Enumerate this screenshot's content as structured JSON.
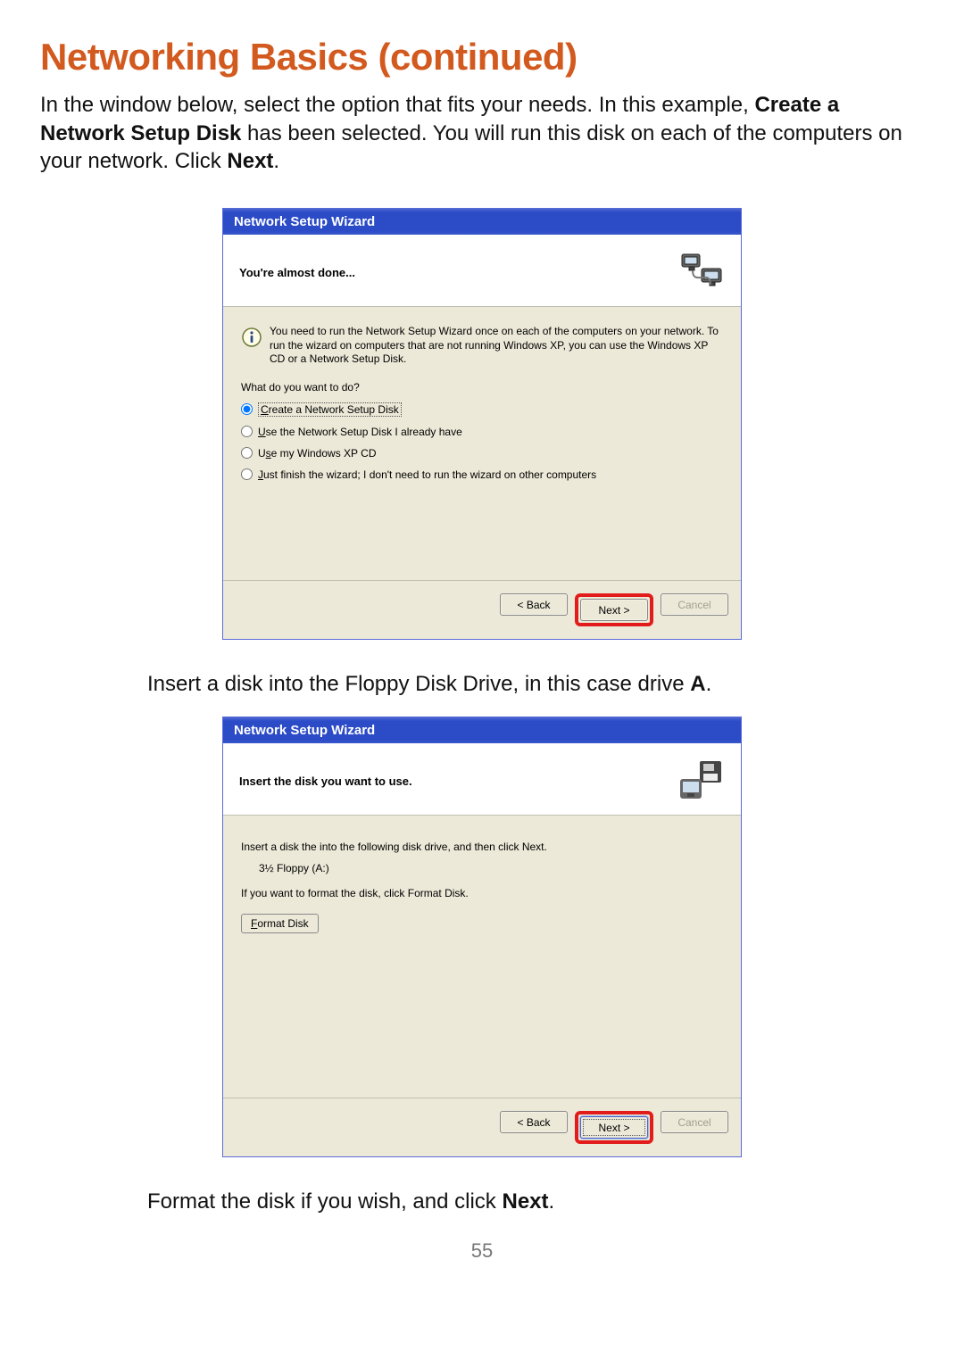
{
  "page": {
    "title": "Networking Basics (continued)",
    "intro_html": "In the window below, select the option that fits your needs.  In this example, <b>Create a Network Setup Disk</b> has been selected.  You will run this disk on each of the computers on your network.  Click <b>Next</b>.",
    "mid_text_html": "Insert a disk into the Floppy Disk Drive, in this case drive <b>A</b>.",
    "foot_text_html": "Format the disk if you wish, and click <b>Next</b>.",
    "page_number": "55"
  },
  "wizard1": {
    "title": "Network Setup Wizard",
    "subtitle": "You're almost done...",
    "info_text": "You need to run the Network Setup Wizard once on each of the computers on your network. To run the wizard on computers that are not running Windows XP, you can use the Windows XP CD or a Network Setup Disk.",
    "prompt": "What do you want to do?",
    "options": [
      {
        "label": "Create a Network Setup Disk",
        "mnemonic": "C",
        "checked": true,
        "focused": true
      },
      {
        "label": "Use the Network Setup Disk I already have",
        "mnemonic": "U",
        "checked": false,
        "focused": false
      },
      {
        "label": "Use my Windows XP CD",
        "mnemonic": "s",
        "checked": false,
        "focused": false
      },
      {
        "label": "Just finish the wizard; I don't need to run the wizard on other computers",
        "mnemonic": "J",
        "checked": false,
        "focused": false
      }
    ],
    "buttons": {
      "back": "< Back",
      "next": "Next >",
      "cancel": "Cancel",
      "back_disabled": false,
      "cancel_disabled": true
    }
  },
  "wizard2": {
    "title": "Network Setup Wizard",
    "subtitle": "Insert the disk you want to use.",
    "line1": "Insert a disk the into the following disk drive, and then click Next.",
    "drive": "3½ Floppy (A:)",
    "line2": "If you want to format the disk, click Format Disk.",
    "format_button": "Format Disk",
    "buttons": {
      "back": "< Back",
      "next": "Next >",
      "cancel": "Cancel",
      "back_disabled": false,
      "cancel_disabled": true
    }
  }
}
